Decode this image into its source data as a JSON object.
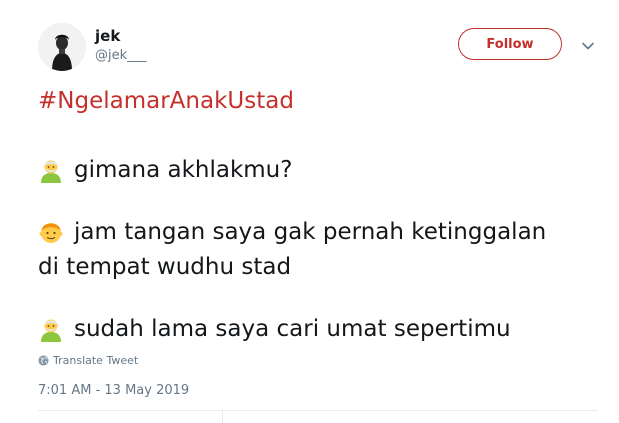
{
  "user": {
    "display_name": "jek",
    "handle": "@jek___"
  },
  "follow_label": "Follow",
  "tweet": {
    "hashtag": "#NgelamarAnakUstad",
    "lines": [
      {
        "emoji": "old-man-emoji",
        "text": "gimana akhlakmu?"
      },
      {
        "emoji": "boy-emoji",
        "text": "jam tangan saya gak pernah ketinggalan",
        "continuation": "di tempat wudhu stad"
      },
      {
        "emoji": "old-man-emoji",
        "text": "sudah lama saya cari umat sepertimu"
      }
    ]
  },
  "translate_label": "Translate Tweet",
  "timestamp": "7:01 AM - 13 May 2019",
  "colors": {
    "accent": "#c4302b",
    "secondary_text": "#657786",
    "primary_text": "#14171a"
  }
}
